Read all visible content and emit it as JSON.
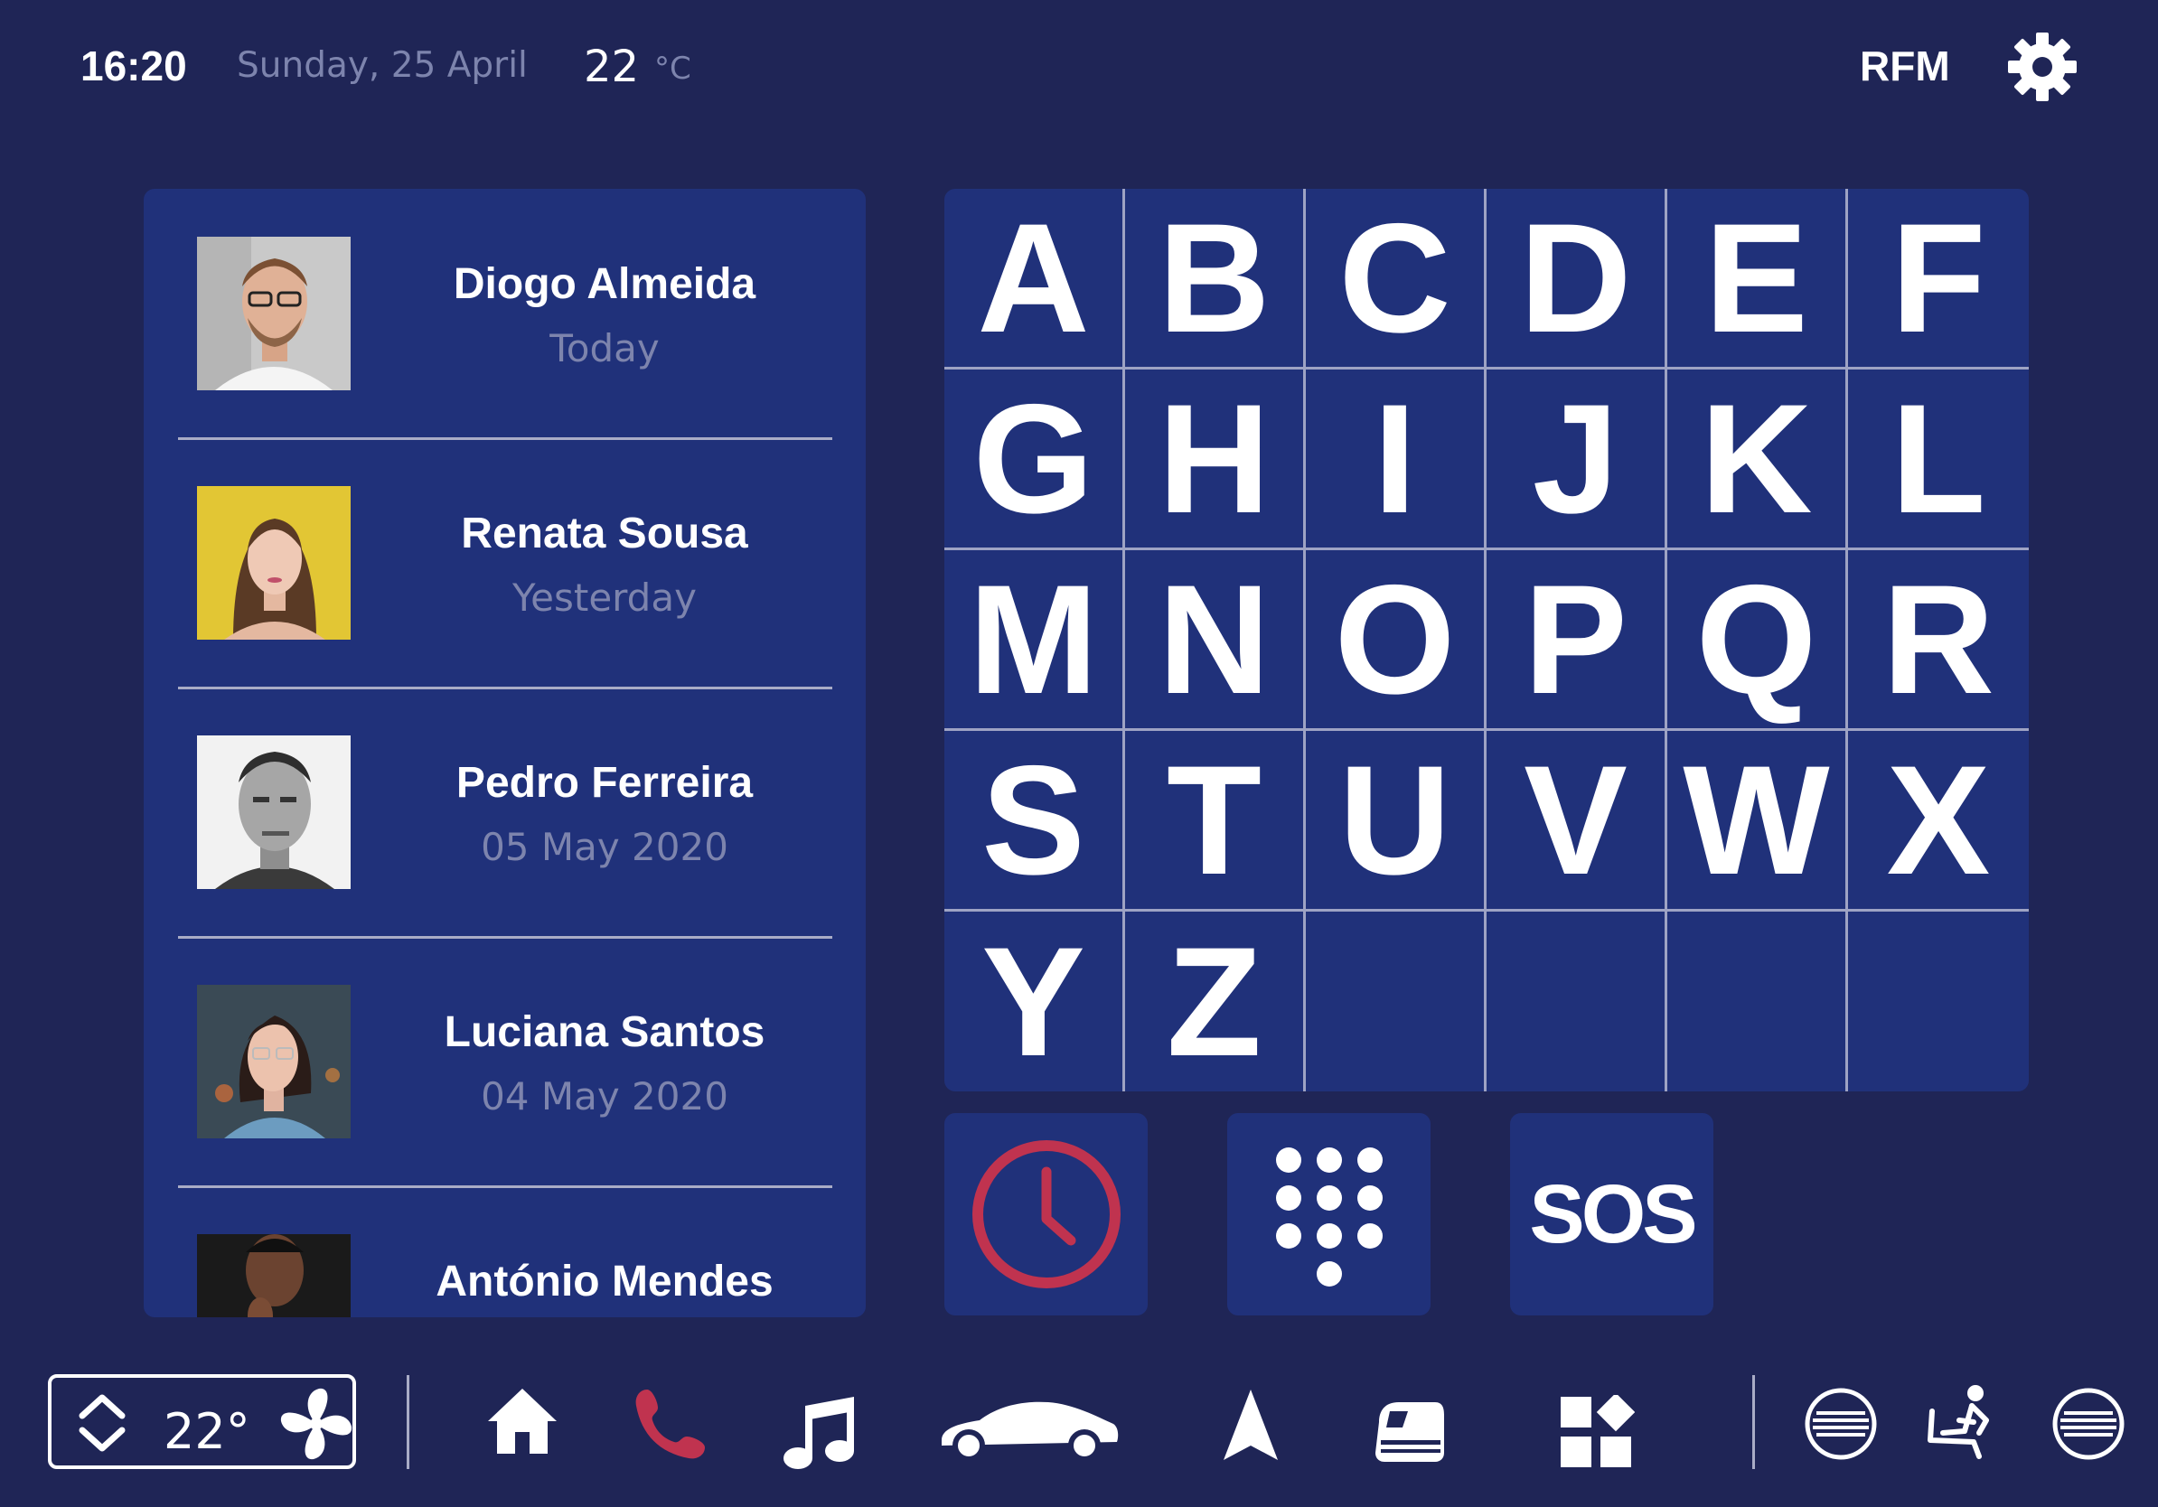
{
  "status_bar": {
    "time": "16:20",
    "date": "Sunday, 25 April",
    "temperature": "22",
    "temperature_unit": "°C",
    "radio": "RFM",
    "settings_icon": "gear-icon"
  },
  "recents": [
    {
      "name": "Diogo Almeida",
      "when": "Today"
    },
    {
      "name": "Renata Sousa",
      "when": "Yesterday"
    },
    {
      "name": "Pedro Ferreira",
      "when": "05 May 2020"
    },
    {
      "name": "Luciana Santos",
      "when": "04 May 2020"
    },
    {
      "name": "António Mendes",
      "when": ""
    }
  ],
  "keyboard": {
    "keys": [
      "A",
      "B",
      "C",
      "D",
      "E",
      "F",
      "G",
      "H",
      "I",
      "J",
      "K",
      "L",
      "M",
      "N",
      "O",
      "P",
      "Q",
      "R",
      "S",
      "T",
      "U",
      "V",
      "W",
      "X",
      "Y",
      "Z",
      "",
      "",
      "",
      ""
    ]
  },
  "actions": {
    "history_icon": "clock-icon",
    "dialpad_icon": "dialpad-icon",
    "sos_label": "SOS"
  },
  "bottom_bar": {
    "climate_temp": "22°",
    "icons": [
      "chevron-updown-icon",
      "fan-icon",
      "home-icon",
      "phone-icon",
      "music-icon",
      "car-icon",
      "navigation-icon",
      "train-icon",
      "apps-icon",
      "seat-heat-left-icon",
      "seat-icon",
      "seat-heat-right-icon"
    ]
  },
  "colors": {
    "background": "#1f2556",
    "panel": "#20317a",
    "accent_red": "#c0334f",
    "muted_text": "#7d84ad"
  }
}
